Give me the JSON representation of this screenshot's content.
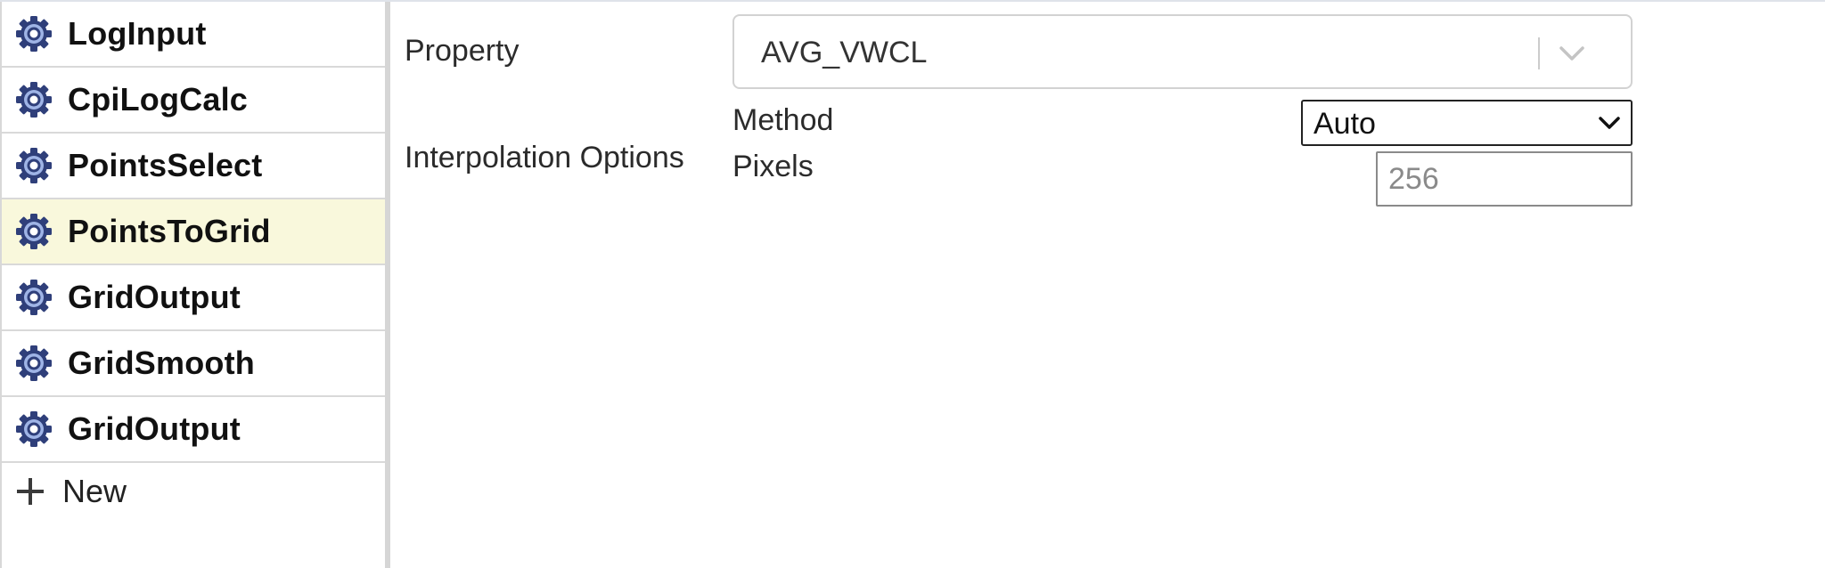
{
  "sidebar": {
    "steps": [
      {
        "label": "LogInput",
        "icon": "gear-icon"
      },
      {
        "label": "CpiLogCalc",
        "icon": "gear-icon"
      },
      {
        "label": "PointsSelect",
        "icon": "gear-icon"
      },
      {
        "label": "PointsToGrid",
        "icon": "gear-icon",
        "selected": true
      },
      {
        "label": "GridOutput",
        "icon": "gear-icon"
      },
      {
        "label": "GridSmooth",
        "icon": "gear-icon"
      },
      {
        "label": "GridOutput",
        "icon": "gear-icon"
      }
    ],
    "new_label": "New",
    "new_icon": "plus-icon"
  },
  "form": {
    "property": {
      "label": "Property",
      "value": "AVG_VWCL"
    },
    "interpolation": {
      "label": "Interpolation Options",
      "method_label": "Method",
      "method_value": "Auto",
      "pixels_label": "Pixels",
      "pixels_placeholder": "256"
    }
  },
  "colors": {
    "selected_row": "#f9f8dc",
    "gear_fill": "#2f3f7a",
    "gear_highlight": "#9fb4e6"
  }
}
